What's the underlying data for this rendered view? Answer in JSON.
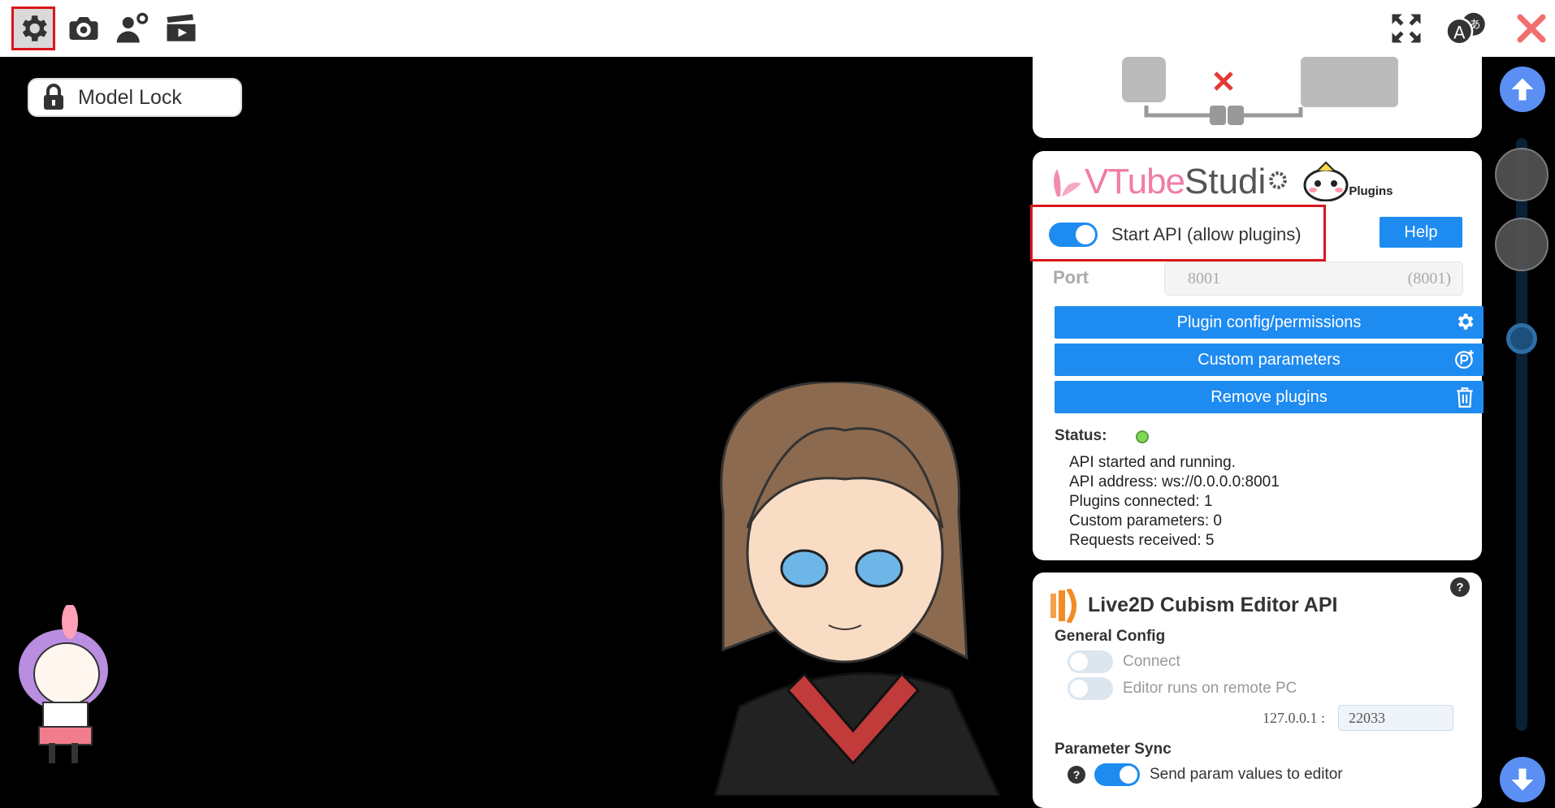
{
  "toolbar": {
    "icons": [
      "gear-icon",
      "camera-icon",
      "user-settings-icon",
      "clapperboard-icon"
    ],
    "right_icons": [
      "fullscreen-icon",
      "language-icon",
      "close-icon"
    ]
  },
  "model_lock": {
    "label": "Model Lock"
  },
  "vtube_panel": {
    "logo_text_vtube": "VTube",
    "logo_text_studio": "Studi",
    "plugins_label": "Plugins",
    "start_api_label": "Start API (allow plugins)",
    "start_api_on": true,
    "help_label": "Help",
    "port_label": "Port",
    "port_value": "8001",
    "port_default": "(8001)",
    "buttons": [
      {
        "label": "Plugin config/permissions"
      },
      {
        "label": "Custom parameters"
      },
      {
        "label": "Remove plugins"
      }
    ],
    "status_label": "Status:",
    "status_color": "#7ed957",
    "status_lines": [
      "API started and running.",
      "API address: ws://0.0.0.0:8001",
      "Plugins connected: 1",
      "Custom parameters: 0",
      "Requests received: 5"
    ]
  },
  "live2d_panel": {
    "title": "Live2D Cubism Editor API",
    "help_symbol": "?",
    "general_config_label": "General Config",
    "connect_label": "Connect",
    "remote_label": "Editor runs on remote PC",
    "ip_label": "127.0.0.1 :",
    "ip_port_value": "22033",
    "param_sync_label": "Parameter Sync",
    "send_param_label": "Send param values to editor"
  },
  "colors": {
    "accent": "#1e8bf1",
    "highlight": "#d9161c",
    "close": "#f26f6f"
  }
}
